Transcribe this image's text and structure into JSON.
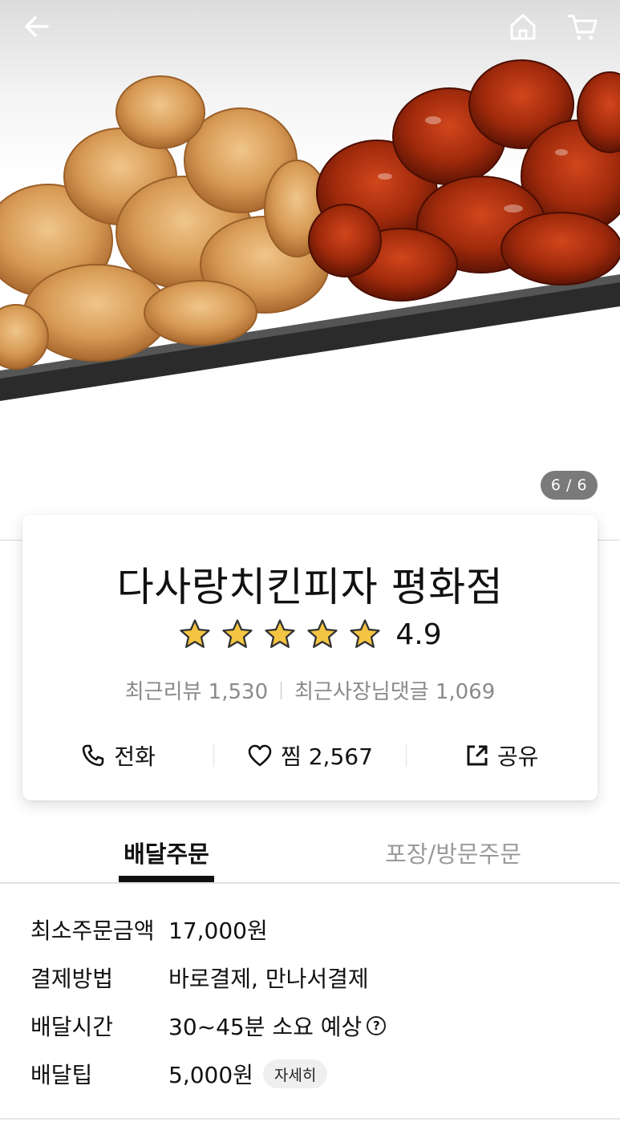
{
  "hero": {
    "counter": "6 / 6"
  },
  "store": {
    "name": "다사랑치킨피자 평화점",
    "rating": "4.9",
    "stars": 5,
    "recent_reviews_label": "최근리뷰 1,530",
    "recent_owner_replies_label": "최근사장님댓글 1,069"
  },
  "actions": {
    "call_label": "전화",
    "favorite_label": "찜 2,567",
    "share_label": "공유"
  },
  "tabs": {
    "delivery_label": "배달주문",
    "pickup_label": "포장/방문주문"
  },
  "info": {
    "rows": [
      {
        "label": "최소주문금액",
        "value": "17,000원"
      },
      {
        "label": "결제방법",
        "value": "바로결제, 만나서결제"
      },
      {
        "label": "배달시간",
        "value": "30~45분 소요 예상",
        "help": "?"
      },
      {
        "label": "배달팁",
        "value": "5,000원",
        "detail": "자세히"
      }
    ]
  },
  "colors": {
    "star_fill": "#f4c542",
    "star_stroke": "#333333",
    "counter_bg": "#7a7a7a",
    "active_tab": "#111111",
    "inactive_tab": "#9a9a9a"
  },
  "icons": [
    "back-arrow-icon",
    "home-icon",
    "cart-icon",
    "phone-icon",
    "heart-icon",
    "share-icon",
    "star-icon",
    "question-circle-icon"
  ]
}
